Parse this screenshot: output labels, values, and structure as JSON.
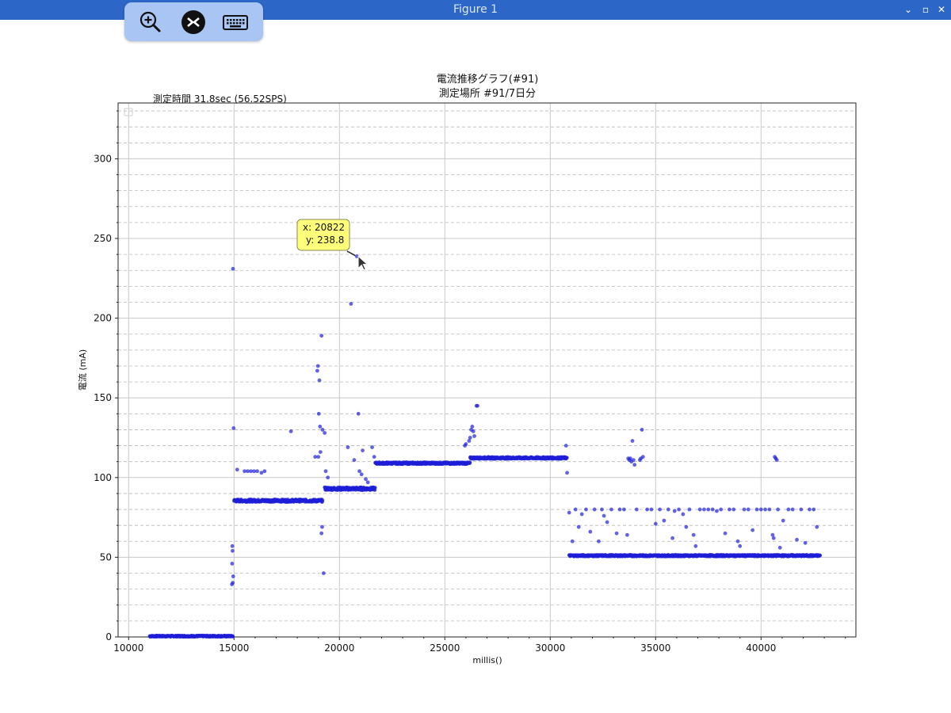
{
  "window": {
    "title": "Figure 1",
    "buttons": [
      "minimize",
      "maximize",
      "close"
    ]
  },
  "toolbar": {
    "icons": [
      "zoom-in-icon",
      "remote-desktop-icon",
      "keyboard-icon"
    ]
  },
  "figure": {
    "title_line1": "電流推移グラフ(#91)",
    "title_line2": "測定場所 #91/7日分",
    "measurement_text": "測定時間  31.8sec (56.52SPS)",
    "tooltip_x": "x: 20822",
    "tooltip_y": "y: 238.8"
  },
  "colors": {
    "titlebar": "#2c67c8",
    "toolbar": "#a9c5f3",
    "points": "#1f1fd8",
    "tooltip_bg": "#ffff7a",
    "grid_major": "#c8c8c8",
    "grid_minor": "#b8b8b8"
  },
  "chart_data": {
    "type": "scatter",
    "title": "電流推移グラフ(#91)\n測定場所 #91/7日分",
    "xlabel": "millis()",
    "ylabel": "電流 (mA)",
    "xlim": [
      9500,
      44500
    ],
    "ylim": [
      0,
      335
    ],
    "xticks": [
      10000,
      15000,
      20000,
      25000,
      30000,
      35000,
      40000
    ],
    "yticks": [
      0,
      50,
      100,
      150,
      200,
      250,
      300
    ],
    "grid": true,
    "minor_grid_dashed": true,
    "legend": "top-left (empty)",
    "segments": [
      {
        "x0": 11000,
        "x1": 14950,
        "y": 0.5,
        "jitter": 0.4
      },
      {
        "x0": 15000,
        "x1": 19200,
        "y": 85.5,
        "jitter": 0.8
      },
      {
        "x0": 19300,
        "x1": 21700,
        "y": 93,
        "jitter": 0.9
      },
      {
        "x0": 21700,
        "x1": 26200,
        "y": 109,
        "jitter": 0.6
      },
      {
        "x0": 26200,
        "x1": 30800,
        "y": 112.3,
        "jitter": 0.6
      },
      {
        "x0": 30900,
        "x1": 42800,
        "y": 51,
        "jitter": 0.5
      }
    ],
    "points": [
      [
        14950,
        231
      ],
      [
        14980,
        131
      ],
      [
        14920,
        57
      ],
      [
        14930,
        54
      ],
      [
        14910,
        46
      ],
      [
        14960,
        38
      ],
      [
        14940,
        34
      ],
      [
        14900,
        33
      ],
      [
        15150,
        105
      ],
      [
        15500,
        104
      ],
      [
        15650,
        104
      ],
      [
        15800,
        104
      ],
      [
        15950,
        104
      ],
      [
        16100,
        104
      ],
      [
        16300,
        103
      ],
      [
        16450,
        104
      ],
      [
        17700,
        129
      ],
      [
        18850,
        113
      ],
      [
        18950,
        167
      ],
      [
        18980,
        170
      ],
      [
        19020,
        140
      ],
      [
        19050,
        161
      ],
      [
        19080,
        132
      ],
      [
        19150,
        189
      ],
      [
        19200,
        130
      ],
      [
        19300,
        128
      ],
      [
        19180,
        69
      ],
      [
        19150,
        65
      ],
      [
        19250,
        40
      ],
      [
        19100,
        116
      ],
      [
        19000,
        113
      ],
      [
        19350,
        104
      ],
      [
        19450,
        100
      ],
      [
        20400,
        119
      ],
      [
        20550,
        209
      ],
      [
        20700,
        111
      ],
      [
        20822,
        238.8
      ],
      [
        20900,
        140
      ],
      [
        20950,
        104
      ],
      [
        21050,
        102
      ],
      [
        21100,
        117
      ],
      [
        21250,
        99
      ],
      [
        21350,
        97
      ],
      [
        21550,
        119
      ],
      [
        21650,
        113
      ],
      [
        25950,
        120
      ],
      [
        26000,
        121
      ],
      [
        26150,
        123
      ],
      [
        26200,
        125
      ],
      [
        26250,
        130
      ],
      [
        26350,
        129
      ],
      [
        26400,
        126
      ],
      [
        26500,
        145
      ],
      [
        26550,
        145
      ],
      [
        26300,
        132
      ],
      [
        30750,
        120
      ],
      [
        30800,
        103
      ],
      [
        30900,
        78
      ],
      [
        31050,
        60
      ],
      [
        31200,
        80
      ],
      [
        31350,
        69
      ],
      [
        31500,
        77
      ],
      [
        31700,
        80
      ],
      [
        31900,
        66
      ],
      [
        32100,
        80
      ],
      [
        32300,
        60
      ],
      [
        32450,
        80
      ],
      [
        32550,
        76
      ],
      [
        32700,
        72
      ],
      [
        32900,
        80
      ],
      [
        33150,
        65
      ],
      [
        33300,
        80
      ],
      [
        33500,
        80
      ],
      [
        33650,
        64
      ],
      [
        33700,
        112
      ],
      [
        33750,
        111
      ],
      [
        33800,
        112
      ],
      [
        33850,
        110
      ],
      [
        33900,
        123
      ],
      [
        33950,
        111
      ],
      [
        34000,
        108
      ],
      [
        34100,
        80
      ],
      [
        34250,
        111
      ],
      [
        34300,
        112
      ],
      [
        34350,
        130
      ],
      [
        34400,
        113
      ],
      [
        34600,
        80
      ],
      [
        34800,
        80
      ],
      [
        35000,
        71
      ],
      [
        35200,
        80
      ],
      [
        35400,
        73
      ],
      [
        35600,
        80
      ],
      [
        35800,
        62
      ],
      [
        35900,
        79
      ],
      [
        36100,
        80
      ],
      [
        36300,
        77
      ],
      [
        36450,
        69
      ],
      [
        36600,
        80
      ],
      [
        36800,
        64
      ],
      [
        36900,
        57
      ],
      [
        37100,
        80
      ],
      [
        37300,
        80
      ],
      [
        37500,
        80
      ],
      [
        37700,
        80
      ],
      [
        37900,
        79
      ],
      [
        38100,
        80
      ],
      [
        38300,
        65
      ],
      [
        38500,
        80
      ],
      [
        38700,
        80
      ],
      [
        38900,
        60
      ],
      [
        39000,
        57
      ],
      [
        39200,
        80
      ],
      [
        39400,
        80
      ],
      [
        39600,
        67
      ],
      [
        39800,
        80
      ],
      [
        40000,
        80
      ],
      [
        40200,
        80
      ],
      [
        40400,
        80
      ],
      [
        40550,
        64
      ],
      [
        40600,
        62
      ],
      [
        40650,
        113
      ],
      [
        40700,
        112
      ],
      [
        40750,
        111
      ],
      [
        40800,
        80
      ],
      [
        40900,
        56
      ],
      [
        41050,
        73
      ],
      [
        41300,
        80
      ],
      [
        41500,
        80
      ],
      [
        41700,
        61
      ],
      [
        41900,
        80
      ],
      [
        42100,
        59
      ],
      [
        42300,
        80
      ],
      [
        42500,
        80
      ],
      [
        42650,
        69
      ]
    ]
  }
}
